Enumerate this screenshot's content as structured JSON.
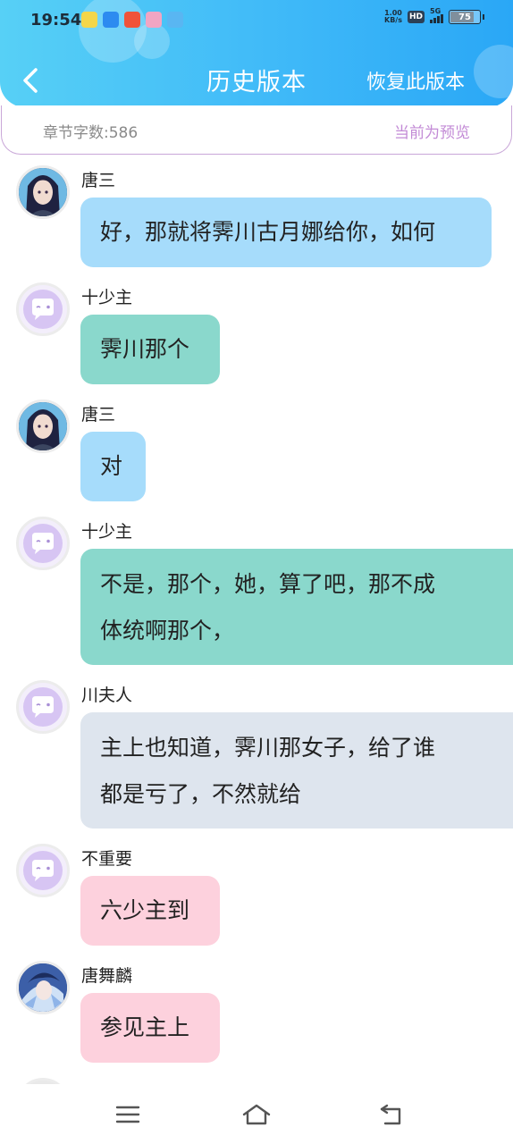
{
  "status_bar": {
    "time": "19:54",
    "net_speed_value": "1.00",
    "net_speed_unit": "KB/s",
    "hd_label": "HD",
    "network_label": "5G",
    "battery": "75"
  },
  "header": {
    "title": "历史版本",
    "restore_label": "恢复此版本"
  },
  "info_bar": {
    "word_count": "章节字数:586",
    "preview_label": "当前为预览"
  },
  "colors": {
    "bubble_blue": "#a6dcfb",
    "bubble_teal": "#8ad8cc",
    "bubble_gray": "#dee5ee",
    "bubble_pink": "#fdd1dd",
    "accent": "#3fb9f8",
    "preview_purple": "#c38bd6"
  },
  "messages": [
    {
      "sender": "唐三",
      "lines": [
        "好，那就将霁川古月娜给你，如何"
      ],
      "avatar": "portrait-tangsan",
      "color": "bubble_blue"
    },
    {
      "sender": "十少主",
      "lines": [
        "霁川那个"
      ],
      "avatar": "default-chat-icon",
      "color": "bubble_teal"
    },
    {
      "sender": "唐三",
      "lines": [
        "对"
      ],
      "avatar": "portrait-tangsan",
      "color": "bubble_blue"
    },
    {
      "sender": "十少主",
      "lines": [
        "不是，那个，她，算了吧，那不成",
        "体统啊那个，"
      ],
      "avatar": "default-chat-icon",
      "color": "bubble_teal"
    },
    {
      "sender": "川夫人",
      "lines": [
        "主上也知道，霁川那女子，给了谁",
        "都是亏了，不然就给"
      ],
      "avatar": "default-chat-icon",
      "color": "bubble_gray"
    },
    {
      "sender": "不重要",
      "lines": [
        "六少主到"
      ],
      "avatar": "default-chat-icon",
      "color": "bubble_pink"
    },
    {
      "sender": "唐舞麟",
      "lines": [
        "参见主上"
      ],
      "avatar": "portrait-tangwulin",
      "color": "bubble_pink"
    }
  ]
}
